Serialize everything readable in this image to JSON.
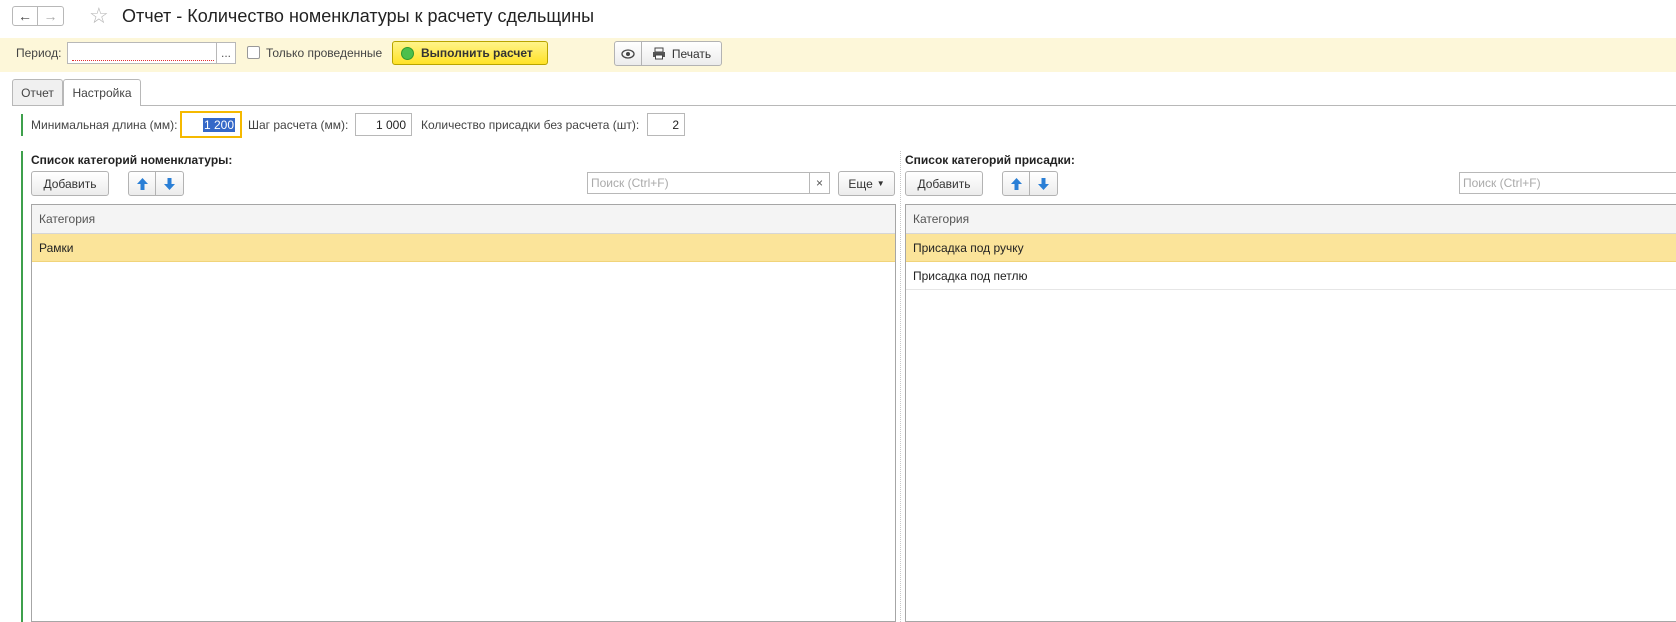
{
  "window": {
    "title": "Отчет - Количество номенклатуры к расчету сдельщины"
  },
  "nav": {
    "back_icon": "←",
    "forward_icon": "→",
    "favorite_icon": "☆"
  },
  "toolbar": {
    "period_label": "Период:",
    "period_value": "",
    "period_choose": "...",
    "only_posted_label": "Только проведенные",
    "run_button": "Выполнить расчет",
    "view_icon": "👁",
    "print_button": "Печать"
  },
  "tabs": [
    {
      "label": "Отчет"
    },
    {
      "label": "Настройка"
    }
  ],
  "settings": {
    "min_length_label": "Минимальная длина (мм):",
    "min_length_value": "1 200",
    "step_label": "Шаг расчета (мм):",
    "step_value": "1 000",
    "qty_label": "Количество присадки без расчета (шт):",
    "qty_value": "2"
  },
  "left_list": {
    "title": "Список категорий номенклатуры:",
    "add_button": "Добавить",
    "search_placeholder": "Поиск (Ctrl+F)",
    "clear_icon": "×",
    "more_button": "Еще",
    "column_header": "Категория",
    "rows": [
      "Рамки"
    ]
  },
  "right_list": {
    "title": "Список категорий присадки:",
    "add_button": "Добавить",
    "search_placeholder": "Поиск (Ctrl+F)",
    "column_header": "Категория",
    "rows": [
      "Присадка под ручку",
      "Присадка под петлю"
    ]
  },
  "colors": {
    "toolbar_bg": "#fdf7d9",
    "selected_row": "#fbe49a",
    "accent_green": "#3ea04c",
    "run_button": "#ffe227",
    "focus_border": "#f5b900"
  }
}
